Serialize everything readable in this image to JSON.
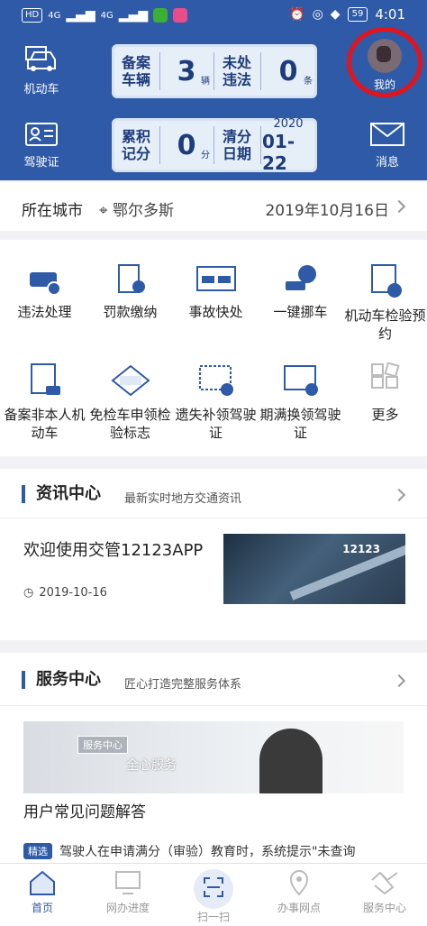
{
  "status": {
    "network": "HD",
    "signal1": "4G",
    "signal2": "4G",
    "battery": "59",
    "time": "4:01"
  },
  "header": {
    "vehicle_label": "机动车",
    "license_label": "驾驶证",
    "messages_label": "消息",
    "me_label": "我的",
    "registered": {
      "label": "备案车辆",
      "count": "3",
      "unit": "辆"
    },
    "violations": {
      "label": "未处违法",
      "count": "0",
      "unit": "条"
    },
    "points": {
      "label": "累积记分",
      "count": "0",
      "unit": "分"
    },
    "clear_date": {
      "label": "清分日期",
      "year": "2020",
      "date": "01-22"
    }
  },
  "city": {
    "label": "所在城市",
    "value": "鄂尔多斯",
    "date": "2019年10月16日"
  },
  "services": [
    {
      "label": "违法处理",
      "icon": "car-violation-icon"
    },
    {
      "label": "罚款缴纳",
      "icon": "fine-payment-icon"
    },
    {
      "label": "事故快处",
      "icon": "accident-icon"
    },
    {
      "label": "一键挪车",
      "icon": "move-car-icon"
    },
    {
      "label": "机动车检验预约",
      "icon": "inspection-booking-icon"
    },
    {
      "label": "备案非本人机动车",
      "icon": "register-car-icon"
    },
    {
      "label": "免检车申领检验标志",
      "icon": "exempt-sticker-icon"
    },
    {
      "label": "遗失补领驾驶证",
      "icon": "lost-license-icon"
    },
    {
      "label": "期满换领驾驶证",
      "icon": "renew-license-icon"
    },
    {
      "label": "更多",
      "icon": "more-icon"
    }
  ],
  "news": {
    "title": "资讯中心",
    "subtitle": "最新实时地方交通资讯",
    "headline": "欢迎使用交管12123APP",
    "date": "2019-10-16",
    "thumb_logo": "12123"
  },
  "service_center": {
    "title": "服务中心",
    "subtitle": "匠心打造完整服务体系",
    "banner_tag": "服务中心",
    "banner_text": "全心服务",
    "faq": "用户常见问题解答",
    "notice_tag": "精选",
    "notice_text": "驾驶人在申请满分（审验）教育时，系统提示\"未查询"
  },
  "tabs": [
    {
      "label": "首页",
      "icon": "home-icon"
    },
    {
      "label": "网办进度",
      "icon": "monitor-icon"
    },
    {
      "label": "扫一扫",
      "icon": "scan-icon"
    },
    {
      "label": "办事网点",
      "icon": "location-icon"
    },
    {
      "label": "服务中心",
      "icon": "handshake-icon"
    }
  ],
  "colors": {
    "brand": "#2e5aa8",
    "highlight_circle": "#e3141b"
  }
}
